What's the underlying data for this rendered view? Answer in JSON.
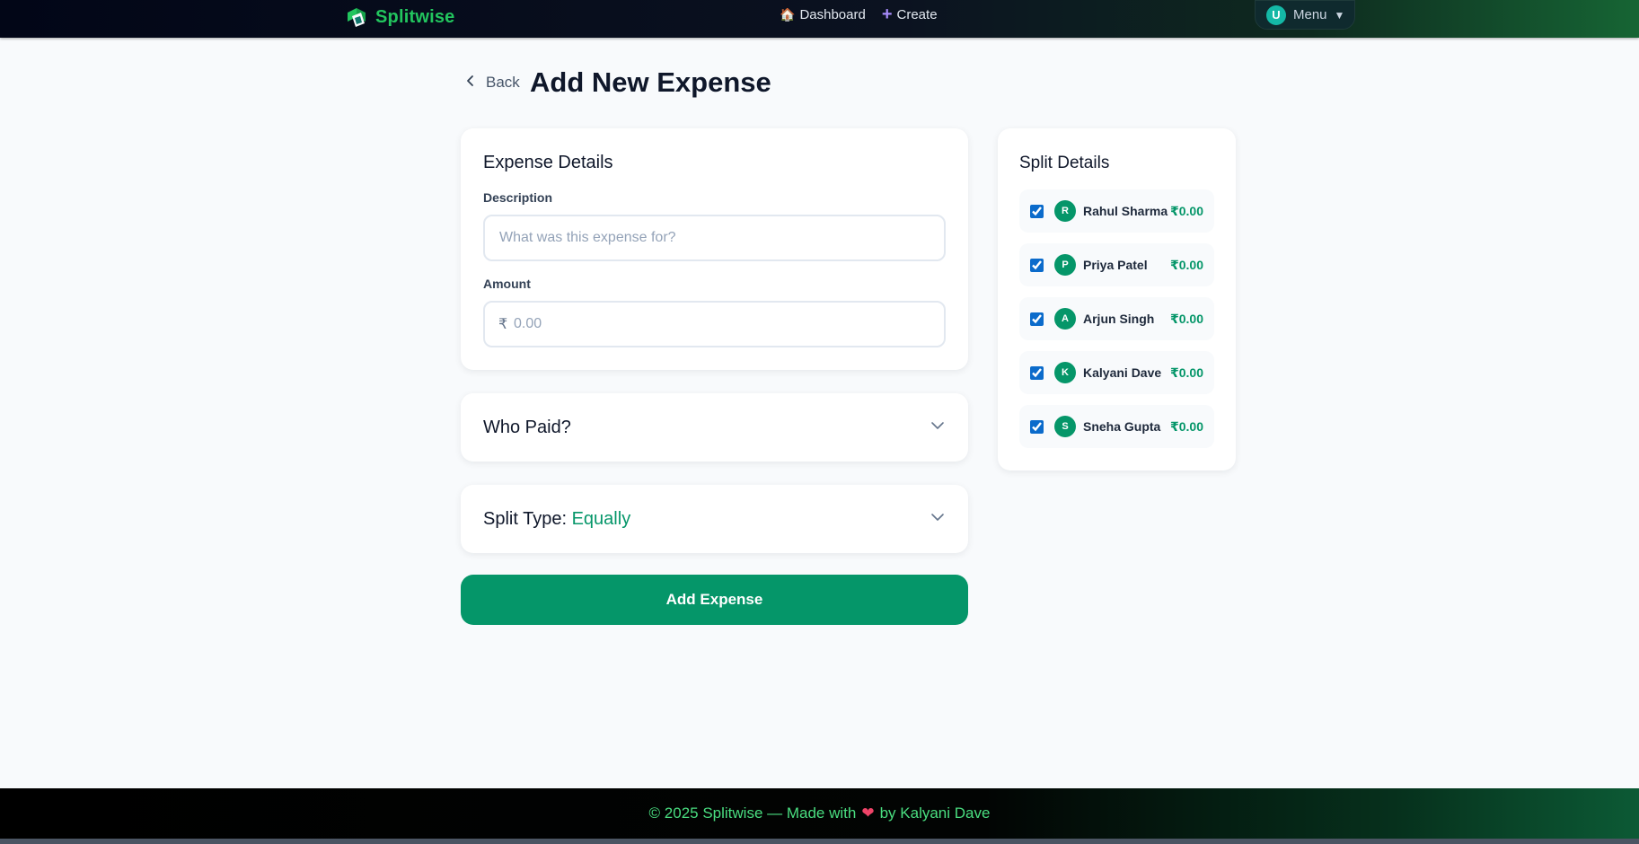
{
  "brand": {
    "name": "Splitwise"
  },
  "nav": {
    "dashboard": {
      "label": "Dashboard",
      "icon": "house-icon"
    },
    "create": {
      "label": "Create",
      "icon": "plus-icon"
    }
  },
  "menu": {
    "avatar_letter": "U",
    "label": "Menu",
    "caret": "▼"
  },
  "page": {
    "back_label": "Back",
    "title": "Add New Expense"
  },
  "expense_details": {
    "title": "Expense Details",
    "description_label": "Description",
    "description_placeholder": "What was this expense for?",
    "description_value": "",
    "amount_label": "Amount",
    "currency_symbol": "₹",
    "amount_placeholder": "0.00",
    "amount_value": ""
  },
  "who_paid": {
    "title": "Who Paid?"
  },
  "split_type": {
    "label": "Split Type:",
    "value": "Equally"
  },
  "add_button": {
    "label": "Add Expense"
  },
  "split_details": {
    "title": "Split Details",
    "members": [
      {
        "initial": "R",
        "name": "Rahul Sharma",
        "amount": "₹0.00",
        "checked": true
      },
      {
        "initial": "P",
        "name": "Priya Patel",
        "amount": "₹0.00",
        "checked": true
      },
      {
        "initial": "A",
        "name": "Arjun Singh",
        "amount": "₹0.00",
        "checked": true
      },
      {
        "initial": "K",
        "name": "Kalyani Dave",
        "amount": "₹0.00",
        "checked": true
      },
      {
        "initial": "S",
        "name": "Sneha Gupta",
        "amount": "₹0.00",
        "checked": true
      }
    ]
  },
  "footer": {
    "prefix": "© 2025 Splitwise — Made with",
    "heart": "❤",
    "suffix": "by Kalyani Dave"
  },
  "colors": {
    "accent": "#059669",
    "brand": "#22c55e",
    "checkbox": "#0b6bcb",
    "footer_text": "#4ade80"
  }
}
